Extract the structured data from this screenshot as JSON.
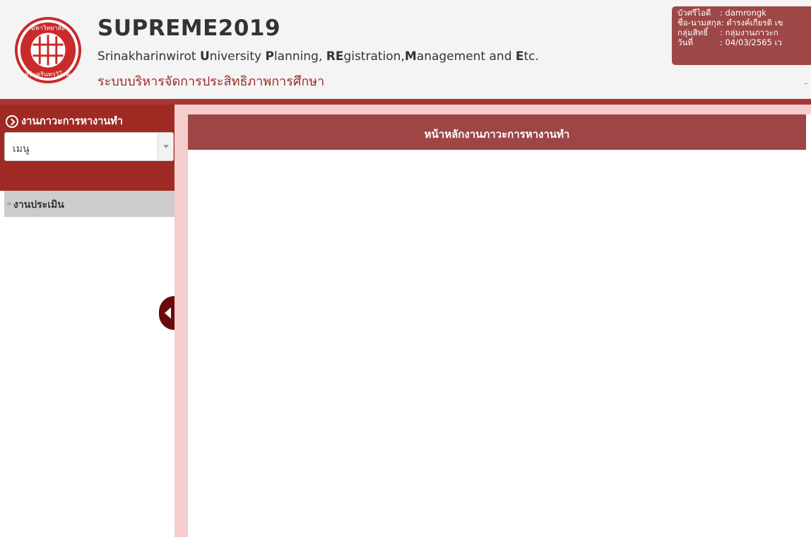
{
  "header": {
    "title": "SUPREME2019",
    "subtitle_parts": [
      {
        "text": "S",
        "bold": false
      },
      {
        "text": "rinakharinwirot ",
        "bold": false
      },
      {
        "text": "U",
        "bold": true
      },
      {
        "text": "niversity ",
        "bold": false
      },
      {
        "text": "P",
        "bold": true
      },
      {
        "text": "lanning, ",
        "bold": false
      },
      {
        "text": "RE",
        "bold": true
      },
      {
        "text": "gistration,",
        "bold": false
      },
      {
        "text": "M",
        "bold": true
      },
      {
        "text": "anagement and ",
        "bold": false
      },
      {
        "text": "E",
        "bold": true
      },
      {
        "text": "tc.",
        "bold": false
      }
    ],
    "subtitle_thai": "ระบบบริหารจัดการประสิทธิภาพการศึกษา",
    "logo_icon": "university-seal-icon",
    "logo_text_top": "มหาวิทยาลัย",
    "logo_text_bottom": "ศรีนครินทรวิโรฒ"
  },
  "user": {
    "id_label": "บัวศรีไอดี",
    "id_value": ": damrongk",
    "name_label": "ชื่อ-นามสกุล:",
    "name_value": "ดำรงค์เกียรติ เข",
    "group_label": "กลุ่มสิทธิ์",
    "group_value": ": กลุ่มงานภาวะก",
    "date_label": "วันที่",
    "date_value": ": 04/03/2565 เว"
  },
  "sidebar": {
    "title": "งานภาวะการหางานทำ",
    "title_icon": "chevron-right-circle-icon",
    "menu_select_value": "เมนู",
    "section_label": "งานประเมิน",
    "section_icon": "triangle-up-icon",
    "toggle_icon": "collapse-left-icon"
  },
  "main": {
    "title": "หน้าหลักงานภาวะการหางานทำ"
  },
  "colors": {
    "brand_red": "#9e2a23",
    "title_bar": "#9e4545",
    "frame_pink": "#f5cdcd",
    "user_panel": "#9e4747"
  }
}
